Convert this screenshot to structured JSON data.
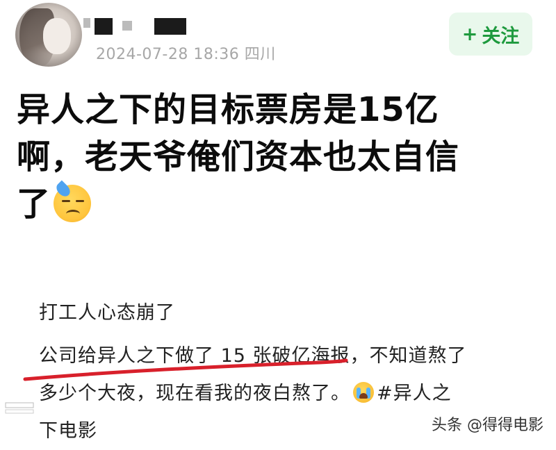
{
  "post": {
    "timestamp_location": "2024-07-28 18:36 四川",
    "follow_label": "关注",
    "follow_plus": "+",
    "headline_part1": "异人之下的目标票房是15亿",
    "headline_part2": "啊，老天爷俺们资本也太自信",
    "headline_part3": "了",
    "icons": {
      "avatar": "avatar-image",
      "emoji_headline": "downcast-sweat-emoji",
      "emoji_body": "crying-emoji"
    }
  },
  "quote": {
    "title": "打工人心态崩了",
    "line_part1": "公司给异人之下做了 15 张破亿海报，不知道熬了",
    "line_part2": "多少个大夜，现在看我的夜白熬了。",
    "hashtag": "#异人之",
    "hashtag_cont": "下电影"
  },
  "colors": {
    "follow_bg": "#e9f8ec",
    "follow_text": "#1e9a3e",
    "meta_text": "#a7a7a7",
    "underline": "#d8202b"
  },
  "watermark": {
    "source": "头条 @得得电影"
  }
}
